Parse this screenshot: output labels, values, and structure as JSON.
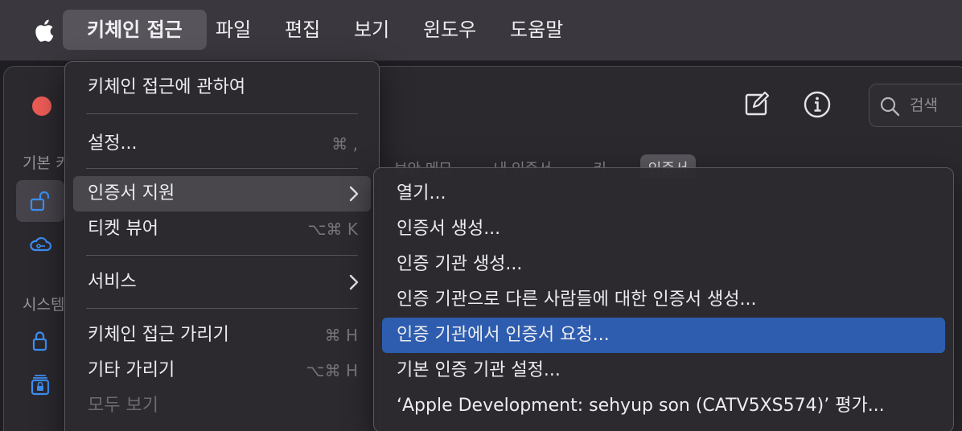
{
  "menubar": {
    "items": [
      "키체인 접근",
      "파일",
      "편집",
      "보기",
      "윈도우",
      "도움말"
    ]
  },
  "window": {
    "sidebar": {
      "header_default": "기본 키",
      "header_system": "시스템"
    },
    "toolbar": {
      "search_placeholder": "검색"
    },
    "tabs": [
      "보안 메모",
      "내 인증서",
      "키",
      "인증서"
    ]
  },
  "app_menu": {
    "about": "키체인 접근에 관하여",
    "settings": "설정...",
    "settings_shortcut": "⌘ ,",
    "cert_assistant": "인증서 지원",
    "ticket_viewer": "티켓 뷰어",
    "ticket_viewer_shortcut": "⌥⌘ K",
    "services": "서비스",
    "hide": "키체인 접근 가리기",
    "hide_shortcut": "⌘ H",
    "hide_others": "기타 가리기",
    "hide_others_shortcut": "⌥⌘ H",
    "show_all": "모두 보기"
  },
  "cert_submenu": {
    "items": [
      "열기...",
      "인증서 생성...",
      "인증 기관 생성...",
      "인증 기관으로 다른 사람들에 대한 인증서 생성...",
      "인증 기관에서 인증서 요청...",
      "기본 인증 기관 설정...",
      "‘Apple Development: sehyup son (CATV5XS574)’ 평가..."
    ],
    "selected_index": 4
  },
  "colors": {
    "selection": "#2e5db0",
    "close_button": "#ec5b56",
    "sidebar_accent": "#3d8ff5"
  }
}
